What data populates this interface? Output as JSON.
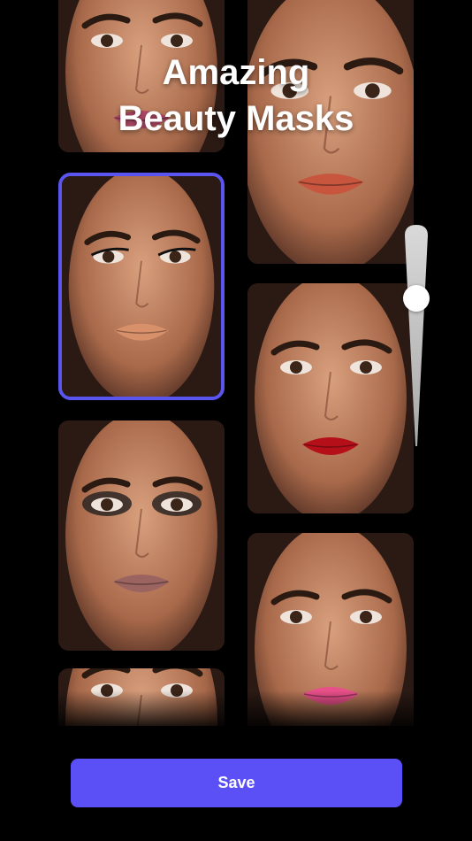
{
  "headline": {
    "line1": "Amazing",
    "line2": "Beauty Masks"
  },
  "tiles": [
    {
      "lip": "#b24a6a",
      "eyes": "natural"
    },
    {
      "lip": "#c8563f",
      "eyes": "natural"
    },
    {
      "lip": "#d8906a",
      "eyes": "winged",
      "selected": true
    },
    {
      "lip": "#b5101a",
      "eyes": "natural"
    },
    {
      "lip": "#9c6460",
      "eyes": "smoky"
    },
    {
      "lip": "#e8508a",
      "eyes": "natural"
    },
    {
      "lip": "",
      "eyes": "natural"
    }
  ],
  "slider": {
    "value": 0.31
  },
  "save_button": {
    "label": "Save"
  },
  "colors": {
    "accent": "#5a50f5",
    "background": "#000000"
  }
}
